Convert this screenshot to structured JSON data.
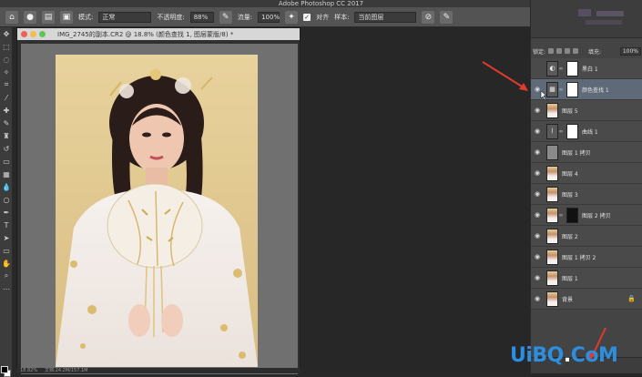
{
  "app": {
    "title": "Adobe Photoshop CC 2017"
  },
  "options_bar": {
    "mode_label": "模式:",
    "mode_value": "正常",
    "opacity_label": "不透明度:",
    "opacity_value": "88%",
    "flow_label": "流量:",
    "flow_value": "100%",
    "align_label": "对齐",
    "sample_label": "样本:",
    "sample_value": "当前图层"
  },
  "document": {
    "title": "IMG_2745的副本.CR2 @ 18.8% (颜色查找 1, 图层蒙版/8) *",
    "zoom": "18.82%",
    "status": "文档:24.2M/157.1M"
  },
  "layers_panel": {
    "lock_label": "锁定:",
    "fill_label": "填充:",
    "fill_value": "100%",
    "layers": [
      {
        "name": "黑白 1",
        "thumb": "adj-bw",
        "mask": "white",
        "visible": false,
        "active": false
      },
      {
        "name": "颜色查找 1",
        "thumb": "adj-lut",
        "mask": "white",
        "visible": true,
        "active": true
      },
      {
        "name": "图层 5",
        "thumb": "photo",
        "mask": "",
        "visible": true,
        "active": false
      },
      {
        "name": "曲线 1",
        "thumb": "adj-curve",
        "mask": "white",
        "visible": true,
        "active": false
      },
      {
        "name": "图层 1 拷贝",
        "thumb": "gray",
        "mask": "",
        "visible": true,
        "active": false
      },
      {
        "name": "图层 4",
        "thumb": "photo-light",
        "mask": "",
        "visible": true,
        "active": false
      },
      {
        "name": "图层 3",
        "thumb": "photo",
        "mask": "",
        "visible": true,
        "active": false
      },
      {
        "name": "图层 2 拷贝",
        "thumb": "photo",
        "mask": "black",
        "visible": true,
        "active": false
      },
      {
        "name": "图层 2",
        "thumb": "photo",
        "mask": "",
        "visible": true,
        "active": false
      },
      {
        "name": "图层 1 拷贝 2",
        "thumb": "photo",
        "mask": "",
        "visible": true,
        "active": false
      },
      {
        "name": "图层 1",
        "thumb": "photo",
        "mask": "",
        "visible": true,
        "active": false
      },
      {
        "name": "背景",
        "thumb": "photo",
        "mask": "",
        "visible": true,
        "active": false,
        "locked": true
      }
    ]
  },
  "watermark": {
    "text_a": "UiBQ",
    "text_b": ".",
    "text_c": "CoM"
  },
  "colors": {
    "accent": "#2d8ee0",
    "arrow": "#e03a2e"
  }
}
